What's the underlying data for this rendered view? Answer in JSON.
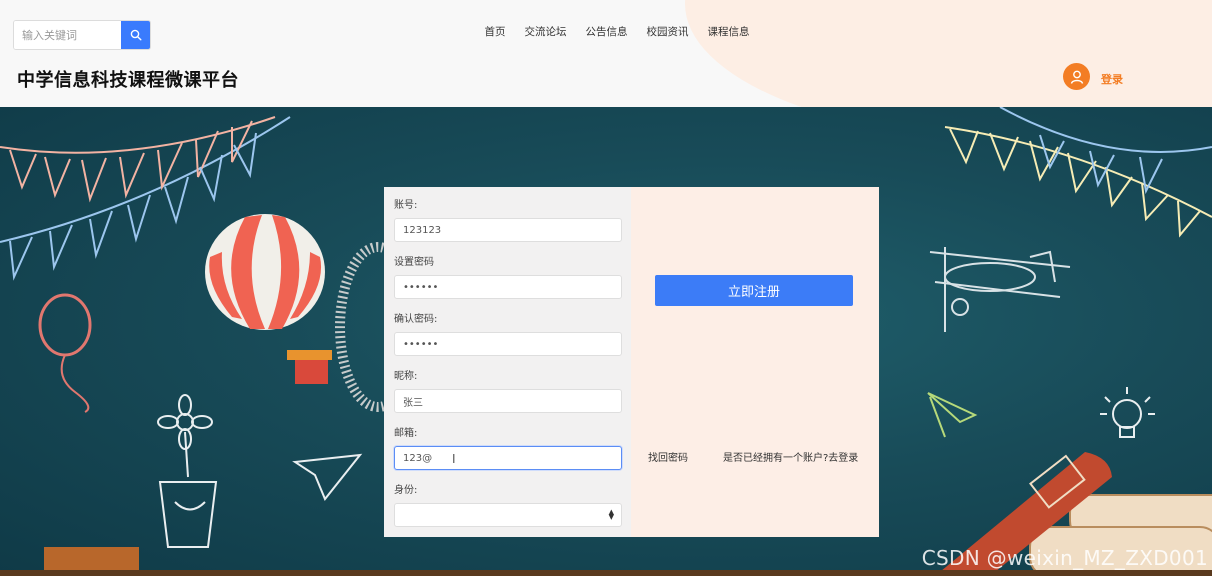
{
  "header": {
    "search": {
      "placeholder": "输入关键词",
      "value": ""
    },
    "nav": [
      "首页",
      "交流论坛",
      "公告信息",
      "校园资讯",
      "课程信息"
    ],
    "title": "中学信息科技课程微课平台",
    "login_label": "登录"
  },
  "form": {
    "account": {
      "label": "账号:",
      "value": "123123"
    },
    "password": {
      "label": "设置密码",
      "value": "••••••"
    },
    "confirm_password": {
      "label": "确认密码:",
      "value": "••••••"
    },
    "nickname": {
      "label": "昵称:",
      "value": "张三"
    },
    "email": {
      "label": "邮箱:",
      "value": "123@"
    },
    "role": {
      "label": "身份:",
      "selected": ""
    }
  },
  "actions": {
    "register_label": "立即注册",
    "forgot_password": "找回密码",
    "has_account": "是否已经拥有一个账户?去登录"
  },
  "watermark": "CSDN @weixin_MZ_ZXD001",
  "colors": {
    "accent_blue": "#3c7cf7",
    "accent_orange": "#f37d24",
    "chalkboard": "#184b58",
    "panel_right": "#fdeee6"
  }
}
